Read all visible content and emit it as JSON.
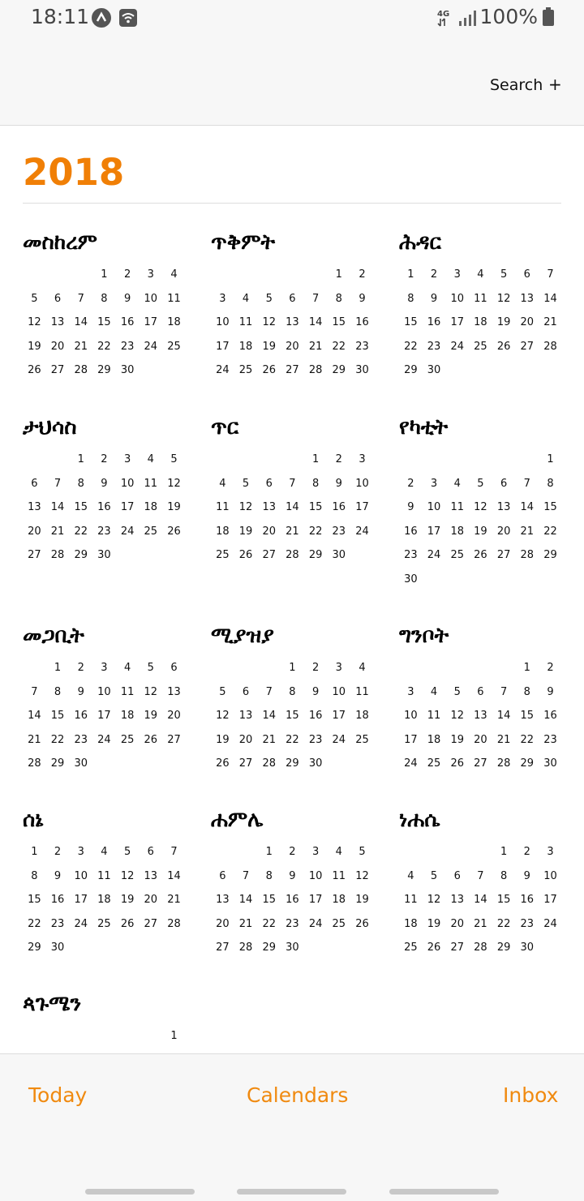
{
  "status_bar": {
    "time": "18:11",
    "network": "4G",
    "battery": "100%",
    "icons": [
      "app-notification-icon",
      "wifi-notification-icon",
      "signal-icon",
      "battery-icon"
    ]
  },
  "header": {
    "search_label": "Search",
    "add_label": "+"
  },
  "year": "2018",
  "accent_color": "#f07f06",
  "months": [
    {
      "name": "መስከረም",
      "offset": 3,
      "days": 30
    },
    {
      "name": "ጥቅምት",
      "offset": 5,
      "days": 30
    },
    {
      "name": "ሕዳር",
      "offset": 0,
      "days": 30
    },
    {
      "name": "ታህሳስ",
      "offset": 2,
      "days": 30
    },
    {
      "name": "ጥር",
      "offset": 4,
      "days": 30
    },
    {
      "name": "የካቲት",
      "offset": 6,
      "days": 30
    },
    {
      "name": "መጋቢት",
      "offset": 1,
      "days": 30
    },
    {
      "name": "ሚያዝያ",
      "offset": 3,
      "days": 30
    },
    {
      "name": "ግንቦት",
      "offset": 5,
      "days": 30
    },
    {
      "name": "ሰኔ",
      "offset": 0,
      "days": 30
    },
    {
      "name": "ሐምሌ",
      "offset": 2,
      "days": 30
    },
    {
      "name": "ነሐሴ",
      "offset": 4,
      "days": 30
    },
    {
      "name": "ጳጉሜን",
      "offset": 6,
      "days": 1
    }
  ],
  "tabs": {
    "today": "Today",
    "calendars": "Calendars",
    "inbox": "Inbox"
  }
}
